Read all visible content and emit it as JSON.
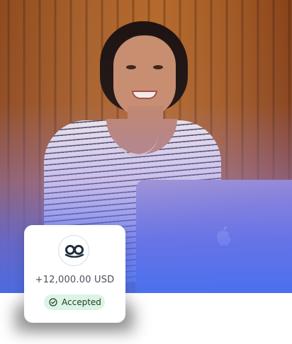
{
  "card": {
    "amount": "+12,000.00 USD",
    "status": "Accepted",
    "avatar_icon": "eyes-logo-icon",
    "status_icon": "check-circle-icon"
  },
  "colors": {
    "badge_bg": "#dcf4e4",
    "badge_text": "#203a2a",
    "accent_blue": "#5a6fe8",
    "amount_text": "#4a4f5a"
  }
}
